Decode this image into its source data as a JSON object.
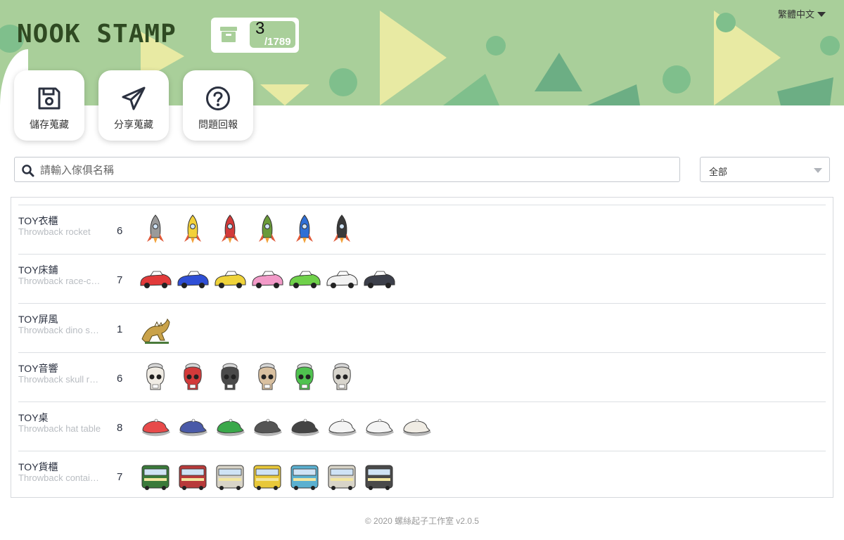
{
  "header": {
    "logo_text": "NOOK STAMP",
    "collected": "3",
    "total": "/1789",
    "language": "繁體中文",
    "colors": {
      "banner": "#a9cf9a",
      "yellow": "#e8eaa3",
      "teal": "#7fbf8c",
      "dark_teal": "#6cae84"
    }
  },
  "actions": [
    {
      "label": "儲存蒐藏",
      "icon": "save-icon"
    },
    {
      "label": "分享蒐藏",
      "icon": "send-icon"
    },
    {
      "label": "問題回報",
      "icon": "help-icon"
    }
  ],
  "search": {
    "placeholder": "請輸入傢俱名稱",
    "value": ""
  },
  "filter": {
    "selected": "全部"
  },
  "rows": [
    {
      "category": "TOY衣櫃",
      "name": "Throwback rocket",
      "count": "6",
      "kind": "rocket",
      "variants": [
        "#9a9a9a",
        "#f2d13a",
        "#d23a3a",
        "#6a9a3a",
        "#2f6fd6",
        "#3a3a3a"
      ]
    },
    {
      "category": "TOY床鋪",
      "name": "Throwback race-car bed",
      "count": "7",
      "kind": "car",
      "variants": [
        "#e23a3a",
        "#2f4fd6",
        "#efd33a",
        "#f29ac8",
        "#6fd14a",
        "#f2f2f2",
        "#3c3f4a"
      ]
    },
    {
      "category": "TOY屏風",
      "name": "Throwback dino screen",
      "count": "1",
      "kind": "dino",
      "variants": [
        "#c9a24a"
      ]
    },
    {
      "category": "TOY音響",
      "name": "Throwback skull radio",
      "count": "6",
      "kind": "skull",
      "variants": [
        "#f0ece4",
        "#d23a3a",
        "#4a4a4a",
        "#d9c0a0",
        "#4fc24f",
        "#d8d5cd"
      ]
    },
    {
      "category": "TOY桌",
      "name": "Throwback hat table",
      "count": "8",
      "kind": "cap",
      "variants": [
        "#e84a4a",
        "#4a5aa8",
        "#3aa84a",
        "#555555",
        "#444444",
        "#f4f4f4",
        "#f4f4f4",
        "#f0ece4"
      ]
    },
    {
      "category": "TOY貨櫃",
      "name": "Throwback container",
      "count": "7",
      "kind": "train",
      "variants": [
        "#3a7a3a",
        "#b83a3a",
        "#d8d4c8",
        "#e8c83a",
        "#5ab0d0",
        "#d8d4c8",
        "#4a4a4a"
      ]
    }
  ],
  "footer": {
    "text": "© 2020 螺絲起子工作室 v2.0.5"
  }
}
